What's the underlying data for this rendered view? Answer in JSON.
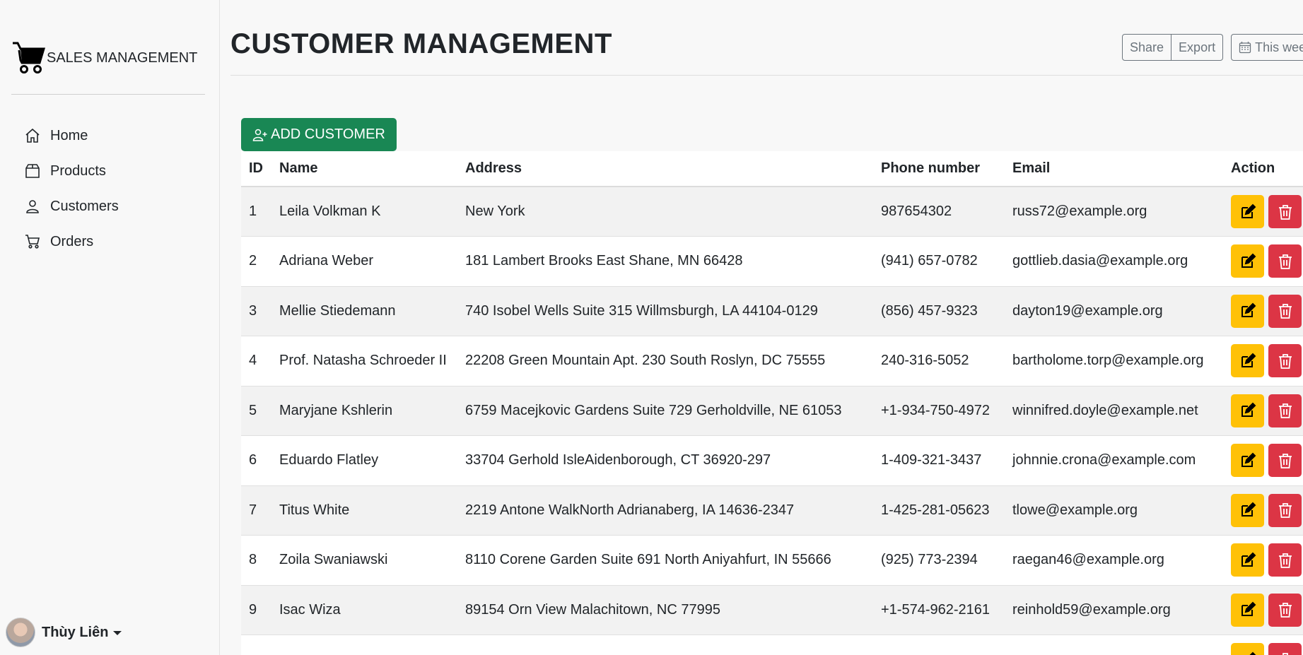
{
  "brand": {
    "name": "SALES MANAGEMENT",
    "icon": "shopping-cart-icon"
  },
  "sidebar": {
    "items": [
      {
        "label": "Home",
        "icon": "home-icon"
      },
      {
        "label": "Products",
        "icon": "box-icon"
      },
      {
        "label": "Customers",
        "icon": "person-icon"
      },
      {
        "label": "Orders",
        "icon": "cart-icon"
      }
    ]
  },
  "user": {
    "name": "Thùy Liên"
  },
  "header": {
    "title": "CUSTOMER MANAGEMENT",
    "share_label": "Share",
    "export_label": "Export",
    "period_label": "This week"
  },
  "add_button": {
    "label": "ADD CUSTOMER"
  },
  "table": {
    "columns": [
      "ID",
      "Name",
      "Address",
      "Phone number",
      "Email",
      "Action"
    ],
    "rows": [
      {
        "id": "1",
        "name": "Leila Volkman K",
        "address": "New York",
        "phone": "987654302",
        "email": "russ72@example.org"
      },
      {
        "id": "2",
        "name": "Adriana Weber",
        "address": "181 Lambert Brooks East Shane, MN 66428",
        "phone": "(941) 657-0782",
        "email": "gottlieb.dasia@example.org"
      },
      {
        "id": "3",
        "name": "Mellie Stiedemann",
        "address": "740 Isobel Wells Suite 315 Willmsburgh, LA 44104-0129",
        "phone": "(856) 457-9323",
        "email": "dayton19@example.org"
      },
      {
        "id": "4",
        "name": "Prof. Natasha Schroeder II",
        "address": "22208 Green Mountain Apt. 230 South Roslyn, DC 75555",
        "phone": "240-316-5052",
        "email": "bartholome.torp@example.org"
      },
      {
        "id": "5",
        "name": "Maryjane Kshlerin",
        "address": "6759 Macejkovic Gardens Suite 729 Gerholdville, NE 61053",
        "phone": "+1-934-750-4972",
        "email": "winnifred.doyle@example.net"
      },
      {
        "id": "6",
        "name": "Eduardo Flatley",
        "address": "33704 Gerhold IsleAidenborough, CT 36920-297",
        "phone": "1-409-321-3437",
        "email": "johnnie.crona@example.com"
      },
      {
        "id": "7",
        "name": "Titus White",
        "address": "2219 Antone WalkNorth Adrianaberg, IA 14636-2347",
        "phone": "1-425-281-05623",
        "email": "tlowe@example.org"
      },
      {
        "id": "8",
        "name": "Zoila Swaniawski",
        "address": "8110 Corene Garden Suite 691 North Aniyahfurt, IN 55666",
        "phone": "(925) 773-2394",
        "email": "raegan46@example.org"
      },
      {
        "id": "9",
        "name": "Isac Wiza",
        "address": "89154 Orn View Malachitown, NC 77995",
        "phone": "+1-574-962-2161",
        "email": "reinhold59@example.org"
      },
      {
        "id": "",
        "name": "",
        "address": "",
        "phone": "",
        "email": ""
      }
    ]
  },
  "colors": {
    "add": "#198754",
    "edit": "#ffc107",
    "delete": "#dc3545"
  }
}
